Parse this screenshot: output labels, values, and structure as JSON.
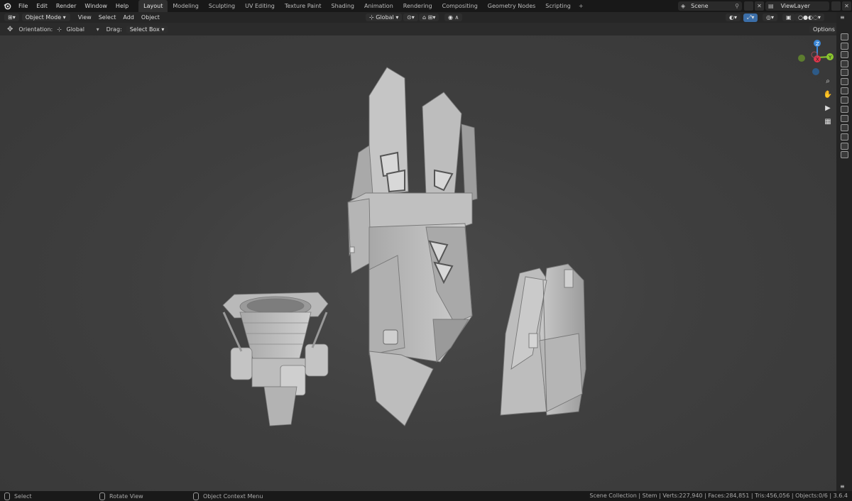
{
  "menu": [
    "File",
    "Edit",
    "Render",
    "Window",
    "Help"
  ],
  "workspace_tabs": [
    "Layout",
    "Modeling",
    "Sculpting",
    "UV Editing",
    "Texture Paint",
    "Shading",
    "Animation",
    "Rendering",
    "Compositing",
    "Geometry Nodes",
    "Scripting"
  ],
  "active_tab": "Layout",
  "scene_name": "Scene",
  "view_layer": "ViewLayer",
  "header": {
    "mode": "Object Mode",
    "menus": [
      "View",
      "Select",
      "Add",
      "Object"
    ],
    "transform_orientation": "Global"
  },
  "tool_settings": {
    "orientation_label": "Orientation:",
    "orientation_value": "Global",
    "drag_label": "Drag:",
    "drag_value": "Select Box",
    "options_label": "Options"
  },
  "gizmo": {
    "z": "Z",
    "y": "Y",
    "x": "X"
  },
  "status": {
    "select": "Select",
    "rotate": "Rotate View",
    "context": "Object Context Menu",
    "stats": "Scene Collection | Stem | Verts:227,940 | Faces:284,851 | Tris:456,056 | Objects:0/6 | 3.6.4"
  },
  "colors": {
    "x_axis": "#e3364c",
    "y_axis": "#8bc72e",
    "z_axis": "#3b87d6",
    "viewport_bg": "#3f3f3f"
  }
}
